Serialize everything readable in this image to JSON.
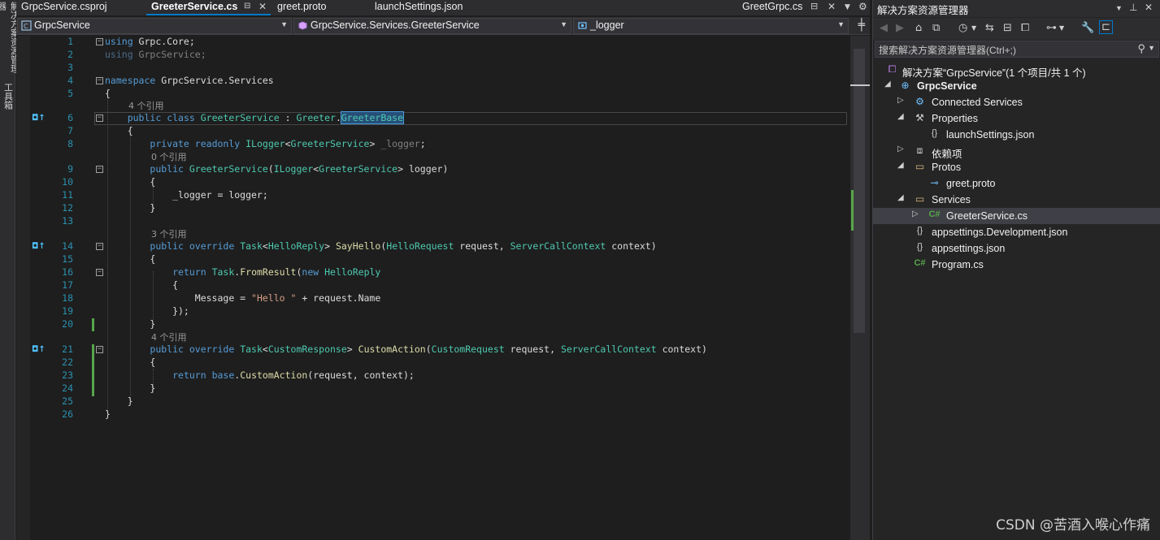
{
  "left_strip": {
    "tab1": "解决方案资源管理器",
    "tab2": "工具箱"
  },
  "tabs": [
    {
      "label": "GrpcService.csproj"
    },
    {
      "label": "GreeterService.cs"
    },
    {
      "label": "greet.proto"
    },
    {
      "label": "launchSettings.json"
    }
  ],
  "tab_right": {
    "label": "GreetGrpc.cs"
  },
  "nav": {
    "project": "GrpcService",
    "class": "GrpcService.Services.GreeterService",
    "member": "_logger"
  },
  "codelens": {
    "l5": "4 个引用",
    "l8": "0 个引用",
    "l13": "3 个引用",
    "l20": "4 个引用"
  },
  "line_numbers": [
    "1",
    "2",
    "3",
    "4",
    "5",
    "6",
    "7",
    "8",
    "9",
    "10",
    "11",
    "12",
    "13",
    "14",
    "15",
    "16",
    "17",
    "18",
    "19",
    "20",
    "21",
    "22",
    "23",
    "24",
    "25",
    "26"
  ],
  "solution_explorer": {
    "title": "解决方案资源管理器",
    "search_placeholder": "搜索解决方案资源管理器(Ctrl+;)",
    "nodes": {
      "solution": "解决方案“GrpcService”(1 个项目/共 1 个)",
      "project": "GrpcService",
      "connected": "Connected Services",
      "properties": "Properties",
      "launch": "launchSettings.json",
      "deps": "依赖项",
      "protos": "Protos",
      "greet": "greet.proto",
      "services": "Services",
      "greeter": "GreeterService.cs",
      "appdev": "appsettings.Development.json",
      "app": "appsettings.json",
      "program": "Program.cs"
    }
  },
  "watermark": "CSDN @苦酒入喉心作痛",
  "colors": {
    "accent": "#007acc",
    "keyword": "#569cd6",
    "type": "#4ec9b0",
    "string": "#d69d85",
    "change": "#57a64a"
  }
}
